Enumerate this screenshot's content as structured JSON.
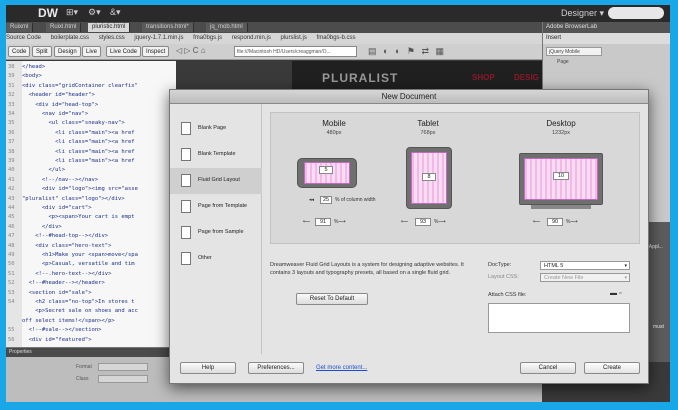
{
  "app": {
    "logo": "DW",
    "menu": [
      "⊞▾",
      "⚙▾",
      "&▾"
    ],
    "workspace": "Designer ▾"
  },
  "file_tabs": [
    "Ruixml",
    "Ruixl.html",
    "pluristic.html",
    "transitions.html*",
    "jq_mob.html"
  ],
  "related_files": [
    "Source Code",
    "boilerplate.css",
    "styles.css",
    "jquery-1.7.1.min.js",
    "fma0bgs.js",
    "respond.min.js",
    "plurslist.js",
    "fma0bgs-b.css"
  ],
  "toolbar": {
    "buttons": [
      "Code",
      "Split",
      "Design",
      "Live",
      "Live Code",
      "Inspect"
    ],
    "address": "file:///Macintosh HD/Users/creaggman/O..."
  },
  "code_lines": [
    {
      "n": "38",
      "t": "</head>"
    },
    {
      "n": "39",
      "t": "<body>"
    },
    {
      "n": "31",
      "t": "<div class=\"gridContainer clearfix\""
    },
    {
      "n": "32",
      "t": "  <header id=\"header\">"
    },
    {
      "n": "33",
      "t": "    <div id=\"head-top\">"
    },
    {
      "n": "34",
      "t": "      <nav id=\"nav\">"
    },
    {
      "n": "35",
      "t": "        <ul class=\"sneaky-nav\">"
    },
    {
      "n": "36",
      "t": "          <li class=\"main\"><a href"
    },
    {
      "n": "37",
      "t": "          <li class=\"main\"><a href"
    },
    {
      "n": "38",
      "t": "          <li class=\"main\"><a href"
    },
    {
      "n": "39",
      "t": "          <li class=\"main\"><a href"
    },
    {
      "n": "40",
      "t": "        </ul>"
    },
    {
      "n": "41",
      "t": "      <!--/nav--></nav>"
    },
    {
      "n": "42",
      "t": "      <div id=\"logo\"><img src=\"asse"
    },
    {
      "n": "43",
      "t": "\"pluralist\" class=\"logo\"></div>"
    },
    {
      "n": "44",
      "t": "      <div id=\"cart\">"
    },
    {
      "n": "45",
      "t": "        <p><span>Your cart is empt"
    },
    {
      "n": "46",
      "t": "      </div>"
    },
    {
      "n": "47",
      "t": "    <!--#head-top--></div>"
    },
    {
      "n": "48",
      "t": "    <div class=\"hero-text\">"
    },
    {
      "n": "49",
      "t": "      <h1>Make your <span>move</spa"
    },
    {
      "n": "50",
      "t": "      <p>Casual, versatile and tim"
    },
    {
      "n": "51",
      "t": "    <!--.hero-text--></div>"
    },
    {
      "n": "52",
      "t": "  <!--#header--></header>"
    },
    {
      "n": "53",
      "t": "  <section id=\"sale\">"
    },
    {
      "n": "54",
      "t": "    <h2 class=\"no-top\">In stores t"
    },
    {
      "n": "",
      "t": "    <p>Secret sale on shoes and acc"
    },
    {
      "n": "",
      "t": "off select items!</span></p>"
    },
    {
      "n": "55",
      "t": "  <!--#sale--></section>"
    },
    {
      "n": "56",
      "t": "  <div id=\"featured\">"
    }
  ],
  "live": {
    "brand": "PLURALIST",
    "nav": [
      "SHOP",
      "DESIG"
    ]
  },
  "right_panel": {
    "title": "Adobe BrowserLab",
    "tab": "Insert",
    "select": "jQuery Mobile",
    "item": "Page",
    "notes": [
      "\"Appl...",
      "must"
    ]
  },
  "properties": {
    "title": "Properties",
    "format": "Format",
    "class": "Class",
    "none": "None"
  },
  "dialog": {
    "title": "New Document",
    "categories": [
      "Blank Page",
      "Blank Template",
      "Fluid Grid Layout",
      "Page from Template",
      "Page from Sample",
      "Other"
    ],
    "selected_category": 2,
    "devices": [
      {
        "name": "Mobile",
        "px": "480px",
        "cols": "5",
        "width": "91"
      },
      {
        "name": "Tablet",
        "px": "768px",
        "cols": "8",
        "width": "93"
      },
      {
        "name": "Desktop",
        "px": "1232px",
        "cols": "10",
        "width": "90"
      }
    ],
    "column_width_label": "% of column width",
    "column_width_value": "25",
    "description": "Dreamweaver Fluid Grid Layouts is a system for designing adaptive websites. It contains 3 layouts and typography presets, all based on a single fluid grid.",
    "reset_button": "Reset To Default",
    "doctype_label": "DocType:",
    "doctype_value": "HTML 5",
    "layout_css_label": "Layout CSS:",
    "layout_css_value": "Create New File",
    "attach_css_label": "Attach CSS file:",
    "help_button": "Help",
    "prefs_button": "Preferences...",
    "more_link": "Get more content...",
    "cancel_button": "Cancel",
    "create_button": "Create"
  }
}
